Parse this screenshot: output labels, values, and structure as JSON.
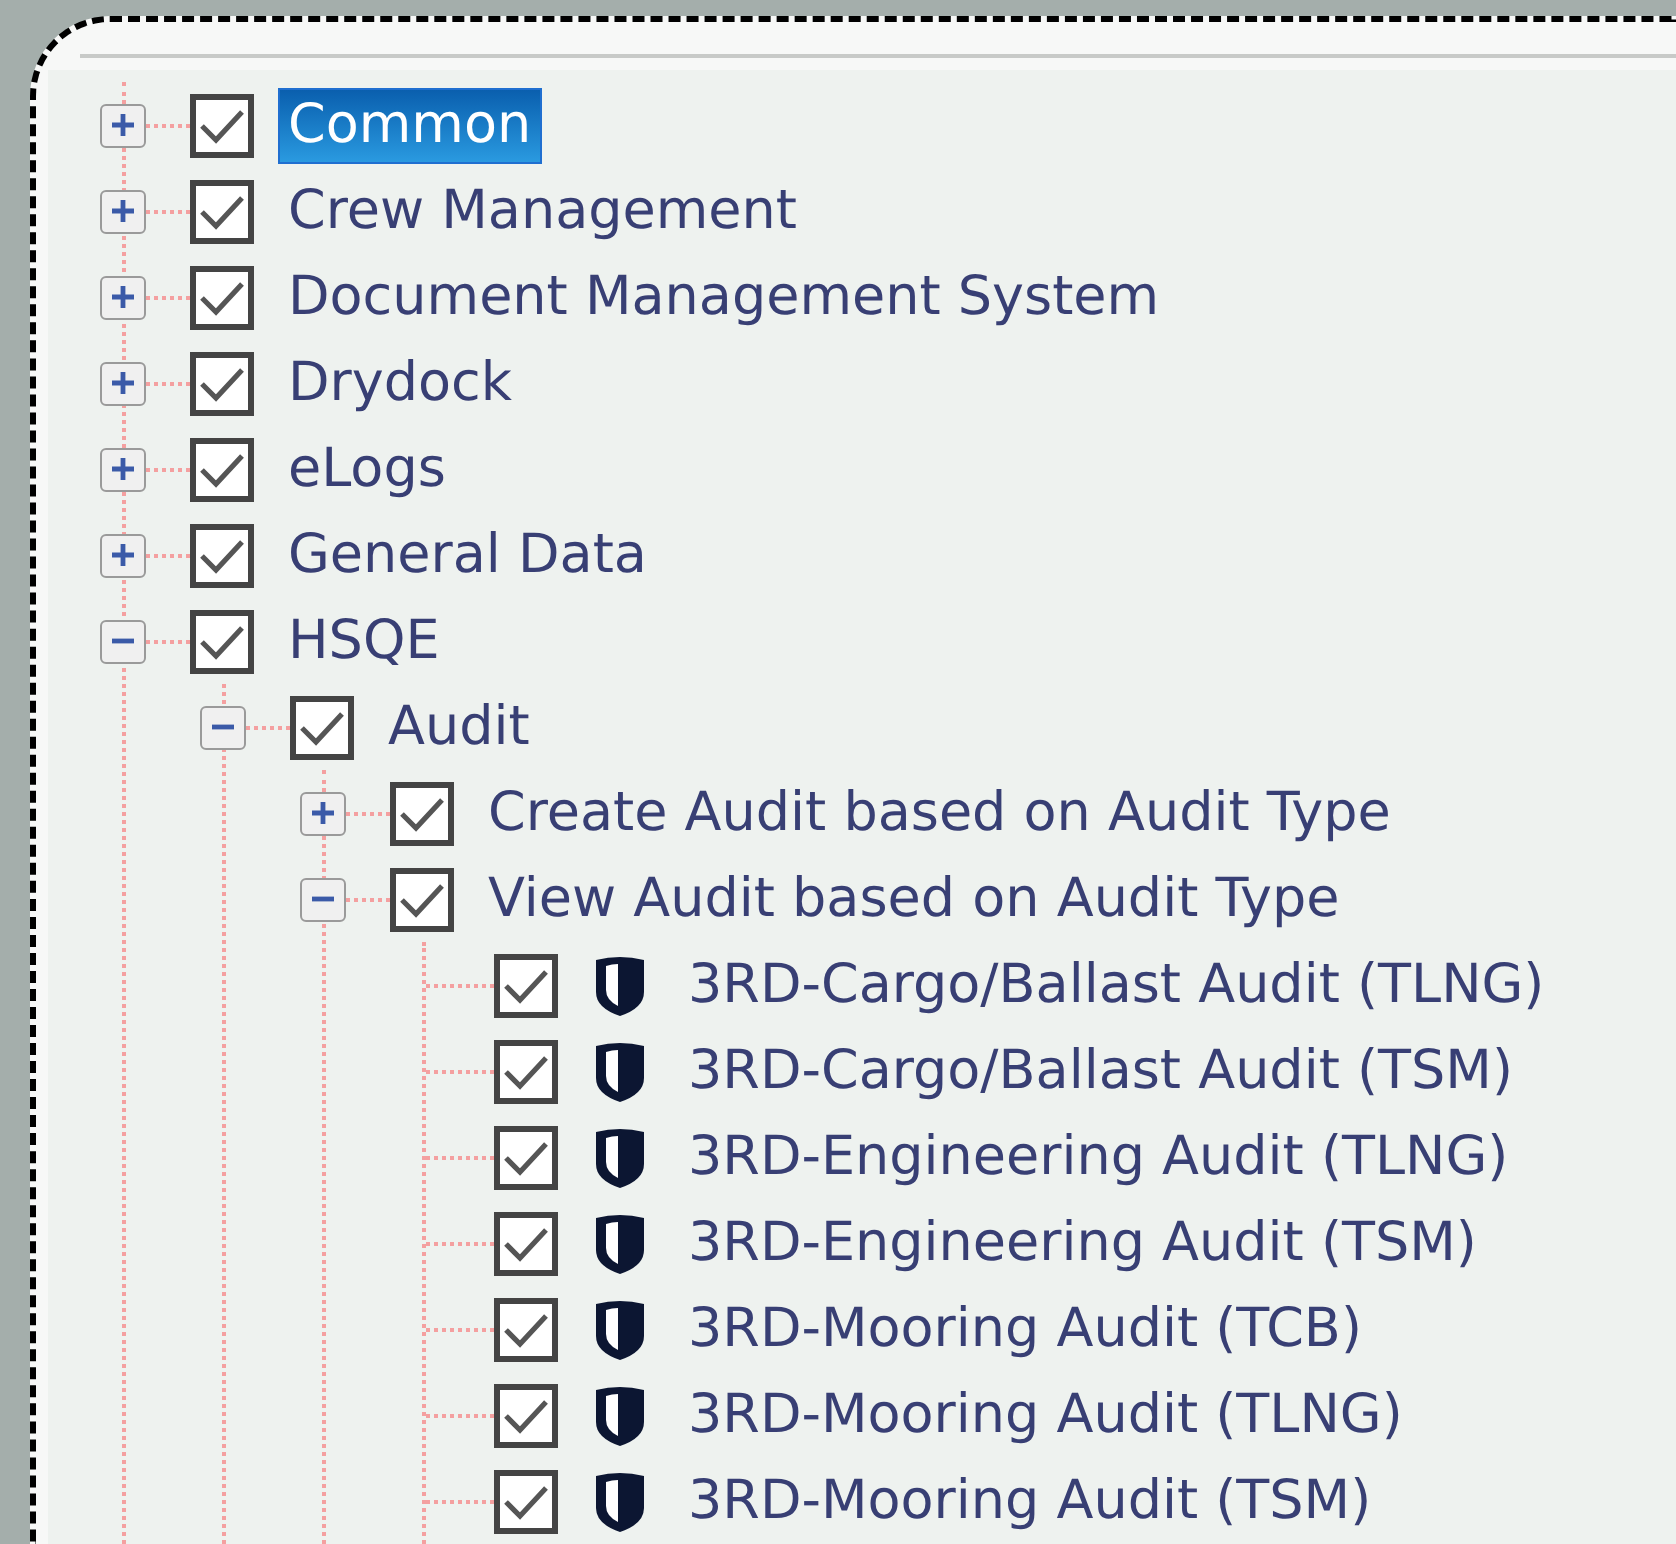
{
  "tree": [
    {
      "label": "Common",
      "kind": "group",
      "expanded": false,
      "checked": true,
      "selected": true
    },
    {
      "label": "Crew Management",
      "kind": "group",
      "expanded": false,
      "checked": true,
      "selected": false
    },
    {
      "label": "Document Management System",
      "kind": "group",
      "expanded": false,
      "checked": true,
      "selected": false
    },
    {
      "label": "Drydock",
      "kind": "group",
      "expanded": false,
      "checked": true,
      "selected": false
    },
    {
      "label": "eLogs",
      "kind": "group",
      "expanded": false,
      "checked": true,
      "selected": false
    },
    {
      "label": "General Data",
      "kind": "group",
      "expanded": false,
      "checked": true,
      "selected": false
    },
    {
      "label": "HSQE",
      "kind": "group",
      "expanded": true,
      "checked": true,
      "selected": false,
      "children": [
        {
          "label": "Audit",
          "kind": "group",
          "expanded": true,
          "checked": true,
          "selected": false,
          "children": [
            {
              "label": "Create Audit based on Audit Type",
              "kind": "group",
              "expanded": false,
              "checked": true,
              "selected": false
            },
            {
              "label": "View Audit based on Audit Type",
              "kind": "group",
              "expanded": true,
              "checked": true,
              "selected": false,
              "children": [
                {
                  "label": "3RD-Cargo/Ballast Audit (TLNG)",
                  "kind": "leaf",
                  "checked": true,
                  "selected": false
                },
                {
                  "label": "3RD-Cargo/Ballast Audit (TSM)",
                  "kind": "leaf",
                  "checked": true,
                  "selected": false
                },
                {
                  "label": "3RD-Engineering Audit (TLNG)",
                  "kind": "leaf",
                  "checked": true,
                  "selected": false
                },
                {
                  "label": "3RD-Engineering Audit (TSM)",
                  "kind": "leaf",
                  "checked": true,
                  "selected": false
                },
                {
                  "label": "3RD-Mooring Audit (TCB)",
                  "kind": "leaf",
                  "checked": true,
                  "selected": false
                },
                {
                  "label": "3RD-Mooring Audit (TLNG)",
                  "kind": "leaf",
                  "checked": true,
                  "selected": false
                },
                {
                  "label": "3RD-Mooring Audit (TSM)",
                  "kind": "leaf",
                  "checked": true,
                  "selected": false
                }
              ]
            }
          ]
        }
      ]
    }
  ]
}
